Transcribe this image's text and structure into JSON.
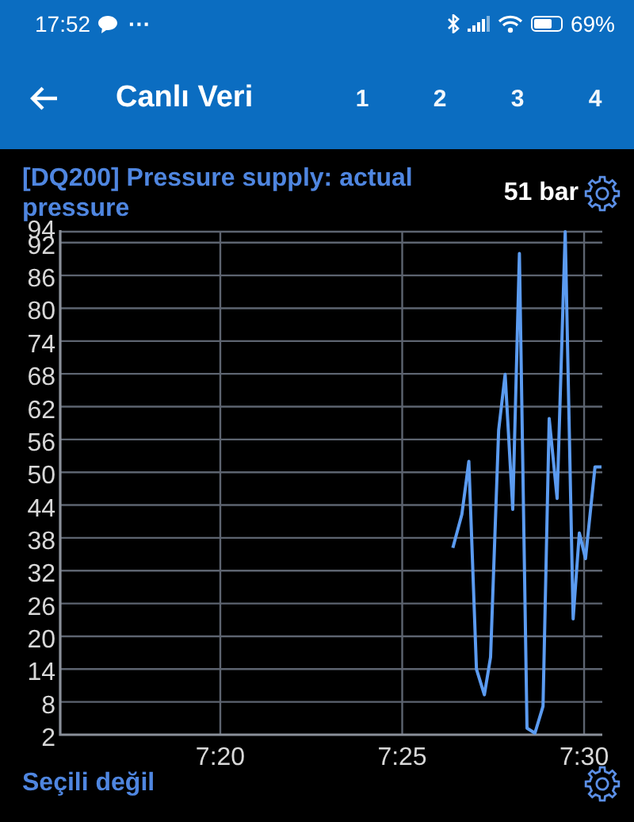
{
  "status_bar": {
    "time": "17:52",
    "more": "···",
    "battery_text": "69%"
  },
  "app_bar": {
    "title": "Canlı Veri",
    "tabs": [
      {
        "label": "1",
        "selected": false
      },
      {
        "label": "2",
        "selected": false
      },
      {
        "label": "3",
        "selected": false
      },
      {
        "label": "4",
        "selected": false
      }
    ]
  },
  "parameter": {
    "title": "[DQ200] Pressure supply: actual pressure",
    "value": "51 bar"
  },
  "chart_data": {
    "type": "line",
    "x": [
      446.39,
      446.64,
      446.83,
      447.04,
      447.26,
      447.43,
      447.65,
      447.83,
      448.04,
      448.22,
      448.43,
      448.65,
      448.87,
      449.04,
      449.26,
      449.48,
      449.7,
      449.87,
      450.04,
      450.3,
      450.48
    ],
    "series": [
      {
        "color": "#5b9bf0",
        "values": [
          36.2,
          42.3,
          52,
          14,
          9.3,
          16.2,
          57.7,
          67.9,
          43.2,
          90,
          3.2,
          2.3,
          7.2,
          59.8,
          45.2,
          94,
          23.2,
          38.9,
          34.2,
          51,
          51
        ]
      }
    ],
    "grid": true,
    "xlim": [
      435.6,
      450.5
    ],
    "ylim": [
      2,
      94
    ],
    "xticks": [
      {
        "value": 440,
        "label": "7:20"
      },
      {
        "value": 445,
        "label": "7:25"
      },
      {
        "value": 450,
        "label": "7:30"
      }
    ],
    "yticks": [
      2,
      8,
      14,
      20,
      26,
      32,
      38,
      44,
      50,
      56,
      62,
      68,
      74,
      80,
      86,
      92,
      94
    ]
  },
  "footer": {
    "label": "Seçili değil"
  }
}
